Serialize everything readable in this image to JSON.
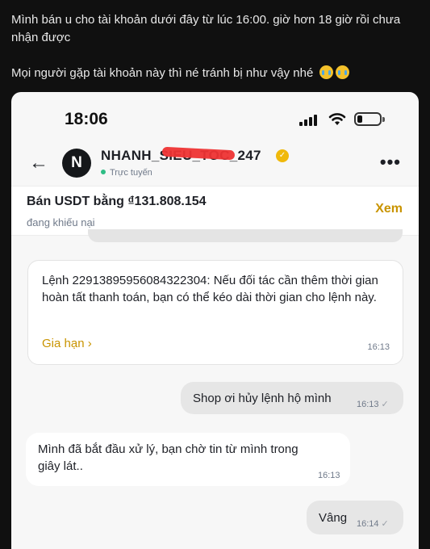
{
  "post": {
    "line1": "Mình bán u cho tài khoản dưới đây từ lúc 16:00. giờ hơn 18 giờ rồi chưa nhận được",
    "line2": "Mọi người gặp tài khoản này thì né tránh bị như vậy nhé",
    "emoji": "crying-face-emoji"
  },
  "status_bar": {
    "time": "18:06"
  },
  "chat_header": {
    "avatar_letter": "N",
    "shop_name": "NHANH_SIEU_TOC_247",
    "online_status": "Trực tuyến"
  },
  "order": {
    "title": "Bán USDT bằng ₫131.808.154",
    "status": "đang khiếu nại",
    "view_label": "Xem"
  },
  "system_message": {
    "text": "Lệnh 22913895956084322304: Nếu đối tác cần thêm thời gian hoàn tất thanh toán, bạn có thể kéo dài thời gian cho lệnh này.",
    "action": "Gia hạn",
    "time": "16:13"
  },
  "messages": [
    {
      "text": "Shop ơi hủy lệnh hộ mình",
      "time": "16:13",
      "direction": "out"
    },
    {
      "text": "Mình đã bắt đầu xử lý, bạn chờ tin từ mình trong giây lát..",
      "time": "16:13",
      "direction": "in"
    },
    {
      "text": "Vâng",
      "time": "16:14",
      "direction": "out"
    }
  ],
  "colors": {
    "accent": "#c99400",
    "online": "#2ebd85",
    "background": "#101010"
  }
}
